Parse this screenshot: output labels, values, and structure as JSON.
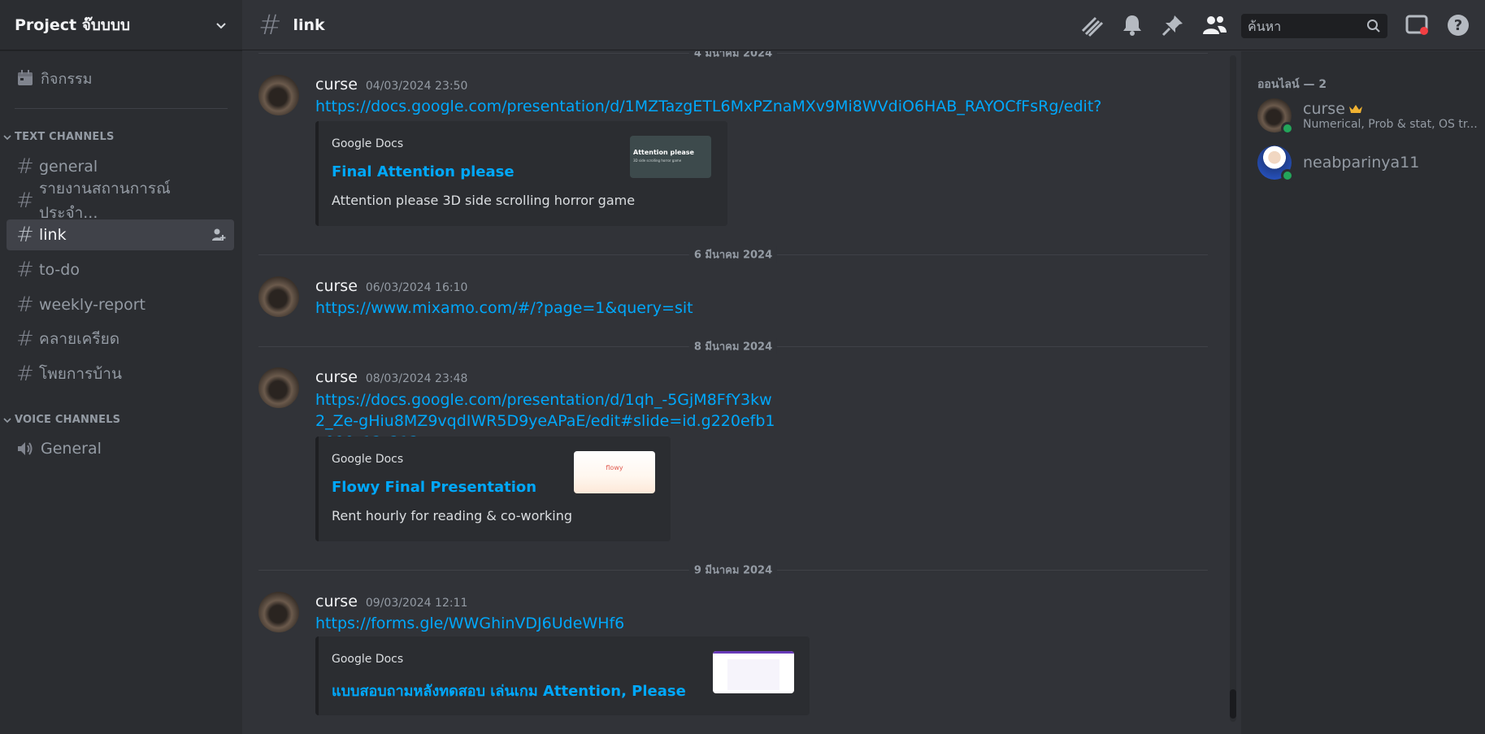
{
  "server": {
    "name": "Project จ๊บบบบ"
  },
  "sidebar": {
    "events_label": "กิจกรรม",
    "text_category": "TEXT CHANNELS",
    "voice_category": "VOICE CHANNELS",
    "text_channels": [
      {
        "label": "general"
      },
      {
        "label": "รายงานสถานการณ์ประจำ..."
      },
      {
        "label": "link"
      },
      {
        "label": "to-do"
      },
      {
        "label": "weekly-report"
      },
      {
        "label": "คลายเครียด"
      },
      {
        "label": "โพยการบ้าน"
      }
    ],
    "voice_channels": [
      {
        "label": "General"
      }
    ]
  },
  "topbar": {
    "channel": "link",
    "search_placeholder": "ค้นหา"
  },
  "messages": {
    "dividers": [
      "4 มีนาคม 2024",
      "6 มีนาคม 2024",
      "8 มีนาคม 2024",
      "9 มีนาคม 2024"
    ],
    "items": [
      {
        "author": "curse",
        "timestamp": "04/03/2024 23:50",
        "link": "https://docs.google.com/presentation/d/1MZTazgETL6MxPZnaMXv9Mi8WVdiO6HAB_RAYOCfFsRg/edit?usp=sharing",
        "embed": {
          "provider": "Google Docs",
          "title": "Final Attention please",
          "description": "Attention please 3D side scrolling horror game",
          "thumb_title": "Attention please",
          "thumb_sub": "3D side scrolling horror game"
        }
      },
      {
        "author": "curse",
        "timestamp": "06/03/2024 16:10",
        "link": "https://www.mixamo.com/#/?page=1&query=sit"
      },
      {
        "author": "curse",
        "timestamp": "08/03/2024 23:48",
        "link": "https://docs.google.com/presentation/d/1qh_-5GjM8FfY3kw2_Ze-gHiu8MZ9vqdIWR5D9yeAPaE/edit#slide=id.g220efb1a090_12_212",
        "embed": {
          "provider": "Google Docs",
          "title": "Flowy Final Presentation",
          "description": "Rent hourly for reading & co-working",
          "thumb_title": "flowy"
        }
      },
      {
        "author": "curse",
        "timestamp": "09/03/2024 12:11",
        "link": "https://forms.gle/WWGhinVDJ6UdeWHf6",
        "embed": {
          "provider": "Google Docs",
          "title": "แบบสอบถามหลังทดสอบ เล่นเกม Attention, Please"
        }
      }
    ]
  },
  "members": {
    "header": "ออนไลน์ — 2",
    "list": [
      {
        "name": "curse",
        "subtitle": "Numerical, Prob & stat, OS tr..."
      },
      {
        "name": "neabparinya11"
      }
    ]
  },
  "colors": {
    "accent_link": "#00a8fc",
    "online": "#23a55a",
    "background": "#313338",
    "sidebar": "#2b2d31"
  }
}
